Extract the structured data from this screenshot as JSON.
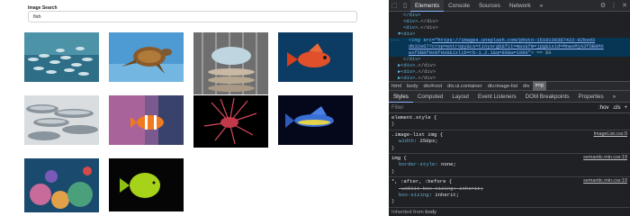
{
  "page": {
    "search_label": "Image Search",
    "search_value": "fish"
  },
  "devtools": {
    "toolbar": {
      "tabs": [
        "Elements",
        "Console",
        "Sources",
        "Network"
      ],
      "more": "»"
    },
    "tree": {
      "lines": [
        [
          "",
          "</div>",
          "",
          "",
          ""
        ],
        [
          "<div>",
          "",
          "",
          "",
          "…</div>"
        ],
        [
          "<div>",
          "",
          "",
          "",
          "…</div>"
        ],
        [
          "▼<div>",
          "",
          "",
          "",
          ""
        ],
        [
          "<img ",
          "src",
          "=\"https://images.unsplash.com/photo-1510130387422-82bed3",
          "",
          ""
        ],
        [
          "",
          "",
          "db32e67?crop=entropy&cs=tinysrgb&fit=max&fm=jpg&ixid=MnwxMjA3fDB8MX",
          "",
          ""
        ],
        [
          "",
          "",
          "wxfDB8fHx8fHx8&ixlib=rb-1.2.1&q=80&w=1080\"",
          "",
          "> == $0"
        ],
        [
          "</div>",
          "",
          "",
          "",
          ""
        ],
        [
          "▶<div>",
          "",
          "",
          "",
          "…</div>"
        ],
        [
          "▶<div>",
          "",
          "",
          "",
          "…</div>"
        ],
        [
          "▶<div>",
          "",
          "",
          "",
          "…</div>"
        ]
      ]
    },
    "breadcrumbs": [
      "html",
      "body",
      "div#root",
      "div.ui.container",
      "div.image-list",
      "div",
      "img"
    ],
    "subtabs": [
      "Styles",
      "Computed",
      "Layout",
      "Event Listeners",
      "DOM Breakpoints",
      "Properties",
      "»"
    ],
    "filter_placeholder": "Filter",
    "filter_controls": [
      ":hov",
      ".cls",
      "+"
    ],
    "rules": [
      {
        "selector": "element.style {",
        "source": "",
        "props": []
      },
      {
        "selector": ".image-list img {",
        "source": "ImageList.css:9",
        "props": [
          {
            "name": "width",
            "value": "250px;",
            "struck": false
          }
        ]
      },
      {
        "selector": "img {",
        "source": "semantic.min.css:19",
        "props": [
          {
            "name": "border-style",
            "value": "none;",
            "struck": false
          }
        ]
      },
      {
        "selector": "*, :after, :before {",
        "source": "semantic.min.css:19",
        "props": [
          {
            "name": "-webkit-box-sizing",
            "value": "inherit;",
            "struck": true
          },
          {
            "name": "box-sizing",
            "value": "inherit;",
            "struck": false
          }
        ]
      }
    ],
    "inherited_prefix": "Inherited from",
    "inherited_from": "body"
  }
}
